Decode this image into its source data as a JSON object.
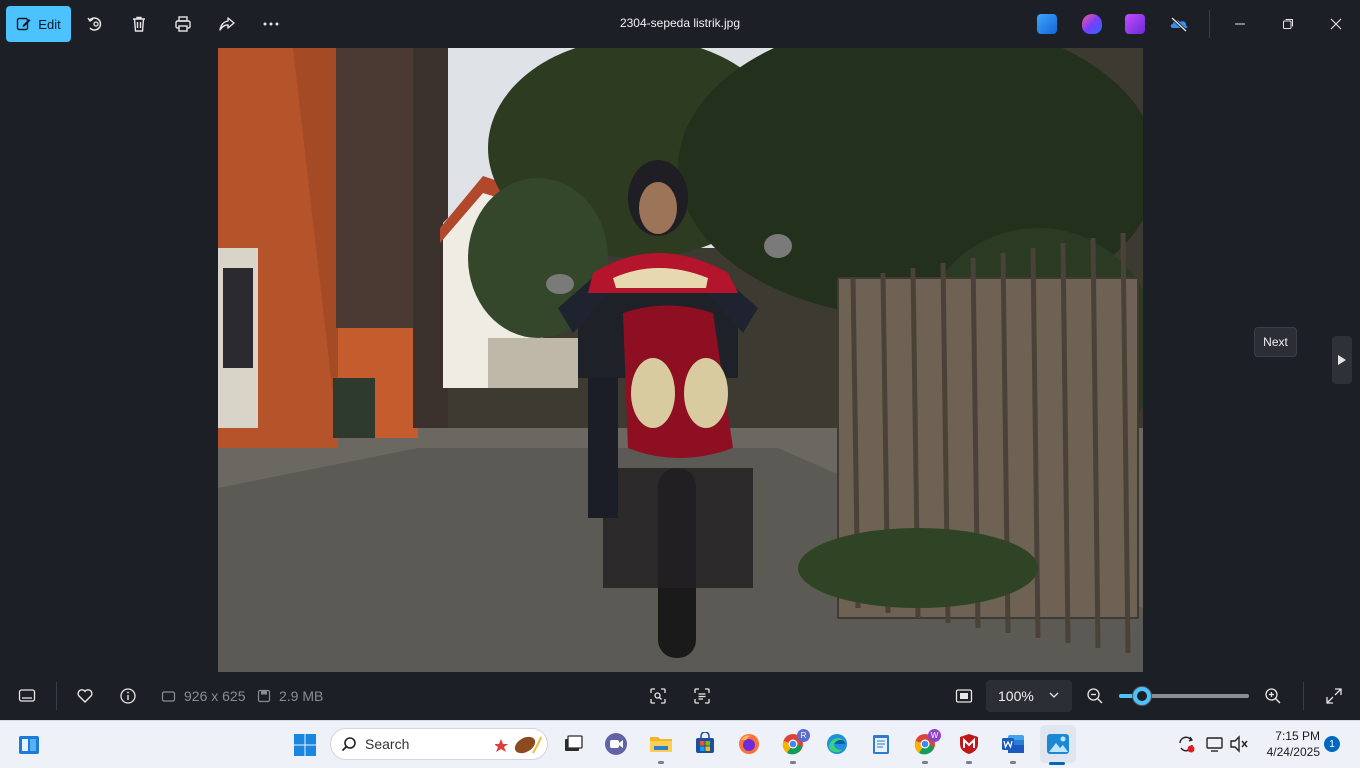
{
  "toolbar": {
    "edit_label": "Edit",
    "file_title": "2304-sepeda listrik.jpg"
  },
  "navigation": {
    "next_tooltip": "Next"
  },
  "bottombar": {
    "dimensions": "926 x 625",
    "file_size": "2.9 MB",
    "zoom_level": "100%",
    "zoom_slider_fraction": 0.18
  },
  "taskbar": {
    "search_placeholder": "Search",
    "time": "7:15 PM",
    "date": "4/24/2025",
    "notification_count": "1",
    "chrome_badge_r": "R",
    "chrome_badge_w": "W"
  },
  "colors": {
    "accent": "#4cc2ff",
    "background": "#1c1f26",
    "taskbar": "#eef2f8"
  }
}
